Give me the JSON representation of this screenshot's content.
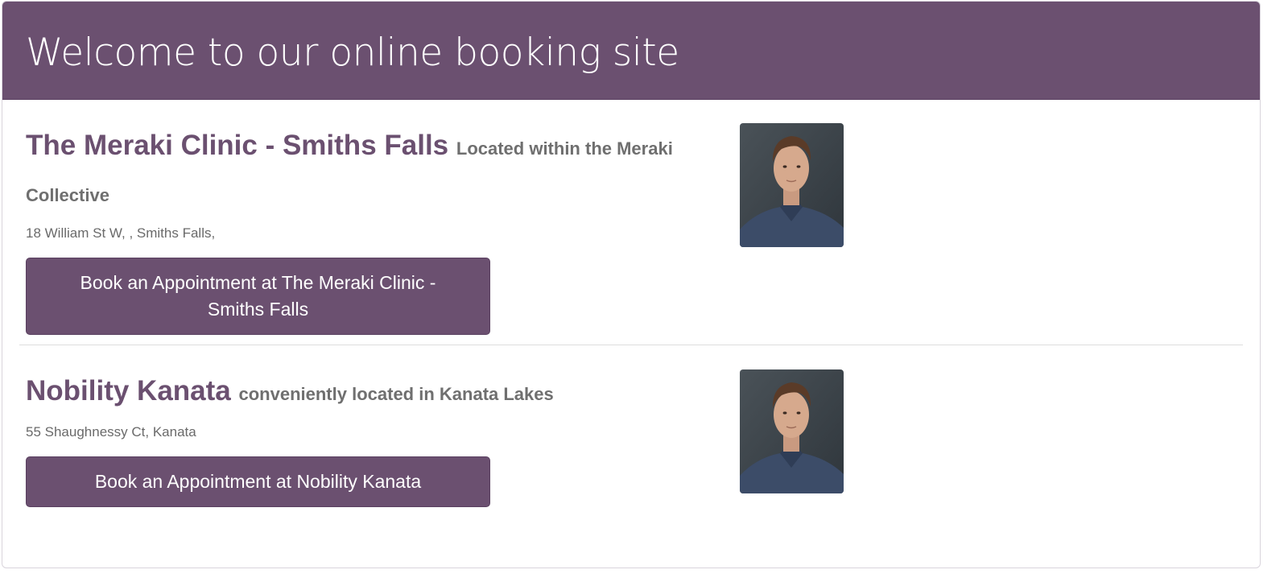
{
  "header": {
    "title": "Welcome to our online booking site",
    "background_color": "#6b5070"
  },
  "locations": [
    {
      "name": "The Meraki Clinic - Smiths Falls",
      "subtitle": "Located within the Meraki Collective",
      "address": "18 William St W, , Smiths Falls,",
      "button_label": "Book an Appointment at The Meraki Clinic - Smiths Falls",
      "photo_icon": "practitioner-photo"
    },
    {
      "name": "Nobility Kanata",
      "subtitle": "conveniently located in Kanata Lakes",
      "address": "55 Shaughnessy Ct, Kanata",
      "button_label": "Book an Appointment at Nobility Kanata",
      "photo_icon": "practitioner-photo"
    }
  ],
  "colors": {
    "accent": "#6b5070",
    "subtitle_text": "#6f6f6f",
    "address_text": "#6a6a6a"
  }
}
